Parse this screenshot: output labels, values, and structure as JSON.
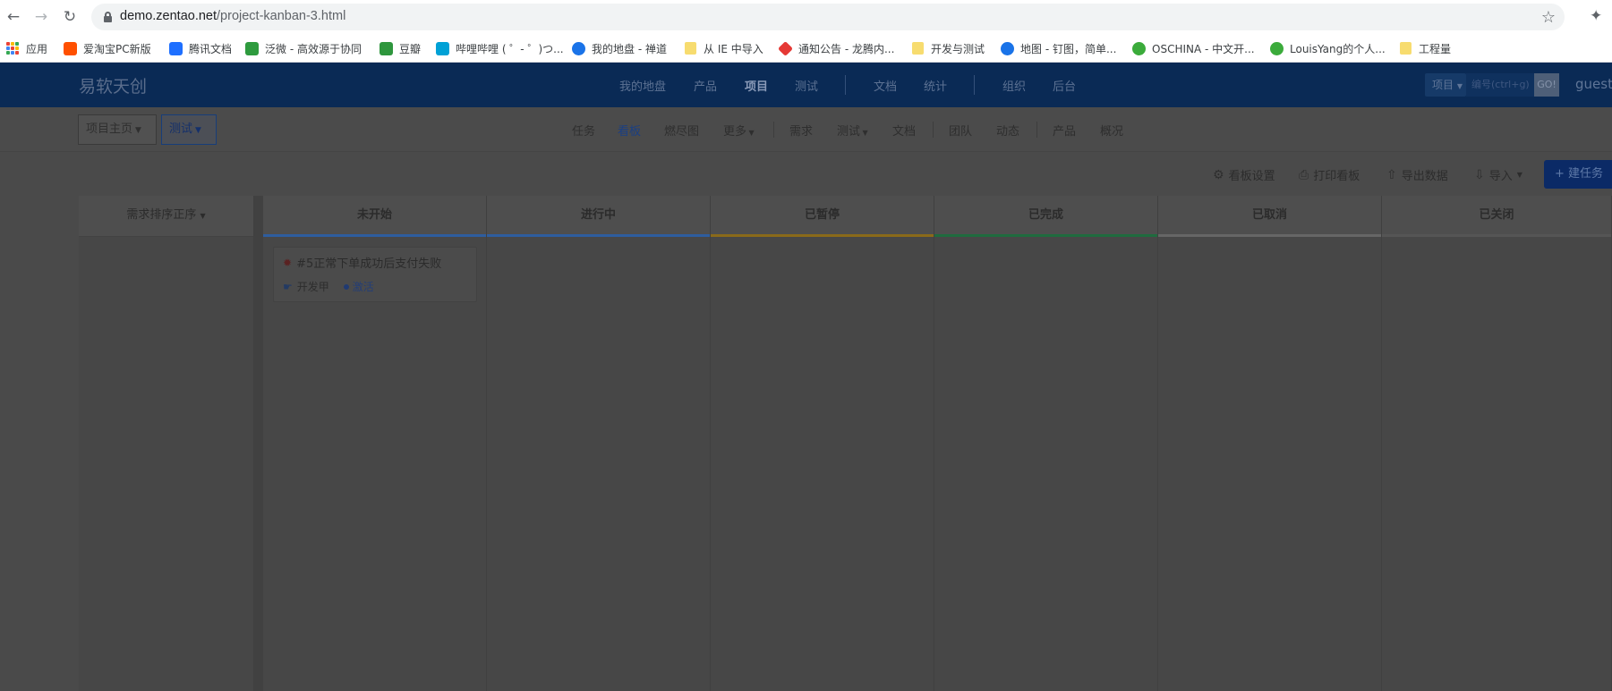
{
  "browser": {
    "url_host": "demo.zentao.net",
    "url_path": "/project-kanban-3.html",
    "bookmarks": [
      {
        "label": "应用",
        "color": "#d93025"
      },
      {
        "label": "爱淘宝PC新版",
        "color": "#ff5000"
      },
      {
        "label": "腾讯文档",
        "color": "#1e6fff"
      },
      {
        "label": "泛微 - 高效源于协同",
        "color": "#2e9b3e"
      },
      {
        "label": "豆瓣",
        "color": "#2e963d"
      },
      {
        "label": "哔哩哔哩 ( ゜- ゜)つ...",
        "color": "#00a1d6"
      },
      {
        "label": "我的地盘 - 禅道",
        "color": "#1a73e8"
      },
      {
        "label": "从 IE 中导入",
        "color": "#f7dc6f"
      },
      {
        "label": "通知公告 - 龙腾内...",
        "color": "#e53935"
      },
      {
        "label": "开发与测试",
        "color": "#f7dc6f"
      },
      {
        "label": "地图 - 钉图，简单...",
        "color": "#1a73e8"
      },
      {
        "label": "OSCHINA - 中文开...",
        "color": "#3bab3b"
      },
      {
        "label": "LouisYang的个人...",
        "color": "#3bab3b"
      },
      {
        "label": "工程量",
        "color": "#f7dc6f"
      }
    ]
  },
  "app": {
    "brand": "易软天创",
    "main_nav": [
      "我的地盘",
      "产品",
      "项目",
      "测试",
      "文档",
      "统计",
      "组织",
      "后台"
    ],
    "search_select": "项目",
    "search_placeholder": "编号(ctrl+g)",
    "go_label": "GO!",
    "user": "guest"
  },
  "subnav": {
    "crumb_home": "项目主页",
    "crumb_current": "测试",
    "items": [
      "任务",
      "看板",
      "燃尽图",
      "更多",
      "需求",
      "测试",
      "文档",
      "团队",
      "动态",
      "产品",
      "概况"
    ]
  },
  "toolbar": {
    "kanban_settings": "看板设置",
    "print_kanban": "打印看板",
    "export_data": "导出数据",
    "import": "导入",
    "create_task": "建任务"
  },
  "kanban": {
    "sort_label": "需求排序正序",
    "columns": [
      {
        "name": "未开始",
        "color": "#2e5d9e"
      },
      {
        "name": "进行中",
        "color": "#2e5d9e"
      },
      {
        "name": "已暂停",
        "color": "#8a6a1a"
      },
      {
        "name": "已完成",
        "color": "#1f6b3e"
      },
      {
        "name": "已取消",
        "color": "#666666"
      },
      {
        "name": "已关闭",
        "color": "#555555"
      }
    ],
    "card": {
      "title": "#5正常下单成功后支付失败",
      "assignee": "开发甲",
      "status": "激活"
    }
  }
}
